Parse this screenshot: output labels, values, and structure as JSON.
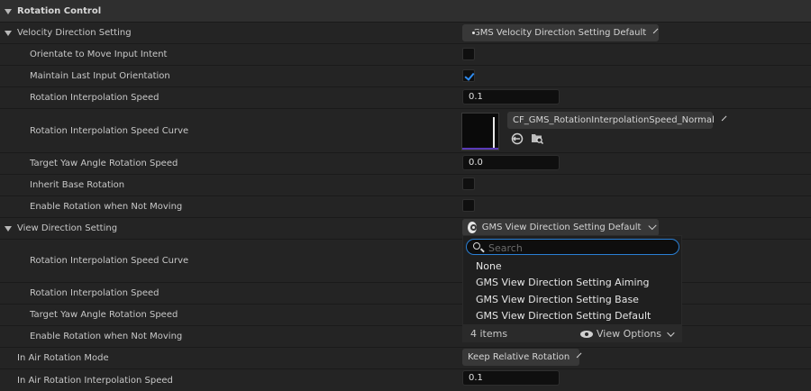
{
  "header": {
    "title": "Rotation Control"
  },
  "velocity": {
    "label": "Velocity Direction Setting",
    "value": "GMS Velocity Direction Setting Default",
    "rows": {
      "orientate": "Orientate to Move Input Intent",
      "maintain": "Maintain Last Input Orientation",
      "interp_speed": "Rotation Interpolation Speed",
      "interp_speed_value": "0.1",
      "interp_curve": "Rotation Interpolation Speed Curve",
      "interp_curve_value": "CF_GMS_RotationInterpolationSpeed_Normal",
      "target_yaw": "Target Yaw Angle Rotation Speed",
      "target_yaw_value": "0.0",
      "inherit_base": "Inherit Base Rotation",
      "enable_rot": "Enable Rotation when Not Moving"
    },
    "checks": {
      "orientate": false,
      "maintain": true,
      "inherit_base": false,
      "enable_rot": false
    }
  },
  "view": {
    "label": "View Direction Setting",
    "value": "GMS View Direction Setting Default",
    "rows": {
      "interp_curve": "Rotation Interpolation Speed Curve",
      "interp_speed": "Rotation Interpolation Speed",
      "target_yaw": "Target Yaw Angle Rotation Speed",
      "enable_rot": "Enable Rotation when Not Moving"
    }
  },
  "air": {
    "mode_label": "In Air Rotation Mode",
    "mode_value": "Keep Relative Rotation",
    "interp_label": "In Air Rotation Interpolation Speed",
    "interp_value": "0.1"
  },
  "dropdown": {
    "search_placeholder": "Search",
    "items": [
      "None",
      "GMS View Direction Setting Aiming",
      "GMS View Direction Setting Base",
      "GMS View Direction Setting Default"
    ],
    "count": "4 items",
    "view_options": "View Options"
  },
  "colors": {
    "accent": "#2f8cf0",
    "curve_line": "#5a3ab8"
  },
  "icons": {
    "expand": "triangle-down-icon",
    "class": "gear-icon",
    "use_selected": "arrow-left-circle-icon",
    "browse": "folder-search-icon",
    "search": "search-icon",
    "view": "eye-icon"
  }
}
